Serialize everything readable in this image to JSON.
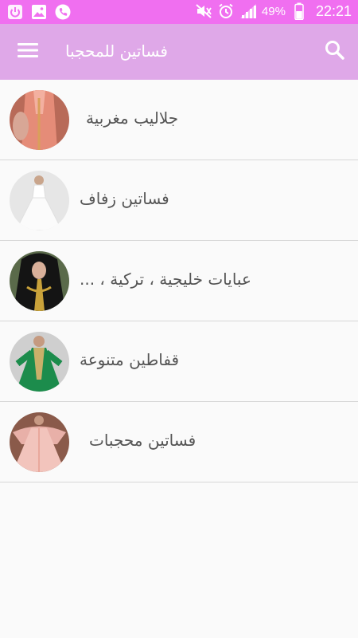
{
  "status_bar": {
    "battery": "49%",
    "time": "22:21",
    "left_icons": [
      "power-icon",
      "image-icon",
      "phone-icon"
    ],
    "right_icons": [
      "mute-icon",
      "alarm-icon",
      "signal-icon",
      "battery-icon"
    ]
  },
  "app_bar": {
    "title": "فساتين للمحجبا",
    "menu_icon": "menu-icon",
    "search_icon": "search-icon",
    "color": "#dfa8e8"
  },
  "list": {
    "items": [
      {
        "label": "جلاليب مغربية"
      },
      {
        "label": "فساتين زفاف"
      },
      {
        "label": "عبايات خليجية ، تركية ، ..."
      },
      {
        "label": "قفاطين متنوعة"
      },
      {
        "label": "فساتين محجبات"
      }
    ]
  },
  "colors": {
    "status_bar": "#f06ff0",
    "divider": "#d7d7d7",
    "text": "#555555"
  }
}
